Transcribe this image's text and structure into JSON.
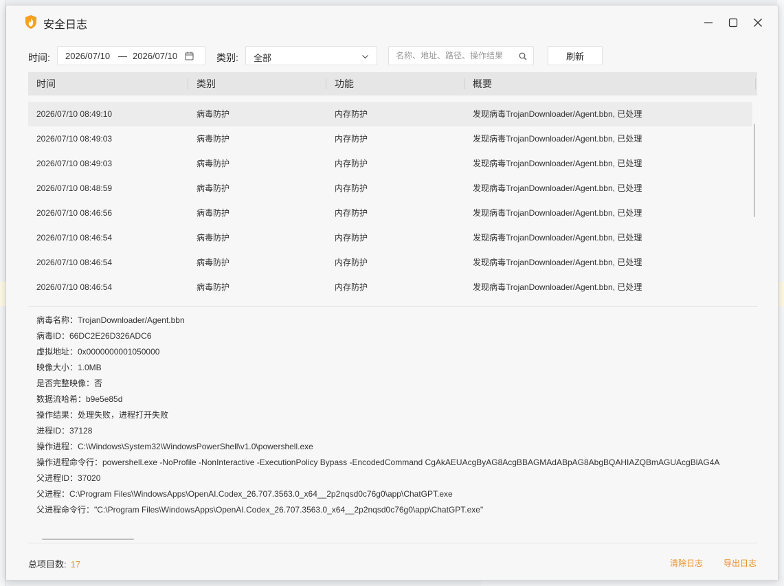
{
  "window": {
    "title": "安全日志"
  },
  "filters": {
    "time_label": "时间:",
    "date_start": "2026/07/10",
    "date_sep": "—",
    "date_end": "2026/07/10",
    "category_label": "类别:",
    "category_value": "全部",
    "search_placeholder": "名称、地址、路径、操作结果",
    "refresh_label": "刷新"
  },
  "table": {
    "columns": [
      "时间",
      "类别",
      "功能",
      "概要"
    ],
    "rows": [
      {
        "time": "2026/07/10 08:49:10",
        "category": "病毒防护",
        "function": "内存防护",
        "summary": "发现病毒TrojanDownloader/Agent.bbn, 已处理"
      },
      {
        "time": "2026/07/10 08:49:03",
        "category": "病毒防护",
        "function": "内存防护",
        "summary": "发现病毒TrojanDownloader/Agent.bbn, 已处理"
      },
      {
        "time": "2026/07/10 08:49:03",
        "category": "病毒防护",
        "function": "内存防护",
        "summary": "发现病毒TrojanDownloader/Agent.bbn, 已处理"
      },
      {
        "time": "2026/07/10 08:48:59",
        "category": "病毒防护",
        "function": "内存防护",
        "summary": "发现病毒TrojanDownloader/Agent.bbn, 已处理"
      },
      {
        "time": "2026/07/10 08:46:56",
        "category": "病毒防护",
        "function": "内存防护",
        "summary": "发现病毒TrojanDownloader/Agent.bbn, 已处理"
      },
      {
        "time": "2026/07/10 08:46:54",
        "category": "病毒防护",
        "function": "内存防护",
        "summary": "发现病毒TrojanDownloader/Agent.bbn, 已处理"
      },
      {
        "time": "2026/07/10 08:46:54",
        "category": "病毒防护",
        "function": "内存防护",
        "summary": "发现病毒TrojanDownloader/Agent.bbn, 已处理"
      },
      {
        "time": "2026/07/10 08:46:54",
        "category": "病毒防护",
        "function": "内存防护",
        "summary": "发现病毒TrojanDownloader/Agent.bbn, 已处理"
      }
    ]
  },
  "details": [
    "病毒名称：TrojanDownloader/Agent.bbn",
    "病毒ID：66DC2E26D326ADC6",
    "虚拟地址：0x0000000001050000",
    "映像大小：1.0MB",
    "是否完整映像：否",
    "数据流哈希：b9e5e85d",
    "操作结果：处理失败，进程打开失败",
    "进程ID：37128",
    "操作进程：C:\\Windows\\System32\\WindowsPowerShell\\v1.0\\powershell.exe",
    "操作进程命令行：powershell.exe -NoProfile -NonInteractive -ExecutionPolicy Bypass -EncodedCommand CgAkAEUAcgByAG8AcgBBAGMAdABpAG8AbgBQAHIAZQBmAGUAcgBlAG4A",
    "父进程ID：37020",
    "父进程：C:\\Program Files\\WindowsApps\\OpenAI.Codex_26.707.3563.0_x64__2p2nqsd0c76g0\\app\\ChatGPT.exe",
    "父进程命令行：\"C:\\Program Files\\WindowsApps\\OpenAI.Codex_26.707.3563.0_x64__2p2nqsd0c76g0\\app\\ChatGPT.exe\""
  ],
  "footer": {
    "total_label": "总项目数:",
    "total_count": "17",
    "clear_label": "清除日志",
    "export_label": "导出日志"
  },
  "colors": {
    "accent": "#e8912c",
    "header_bg": "#e6e6e6",
    "window_bg": "#f7f7f7"
  },
  "icons": {
    "app": "flame-shield-icon",
    "minimize": "minimize-icon",
    "maximize": "maximize-icon",
    "close": "close-icon",
    "calendar": "calendar-icon",
    "dropdown": "chevron-down-icon",
    "search": "search-icon"
  }
}
